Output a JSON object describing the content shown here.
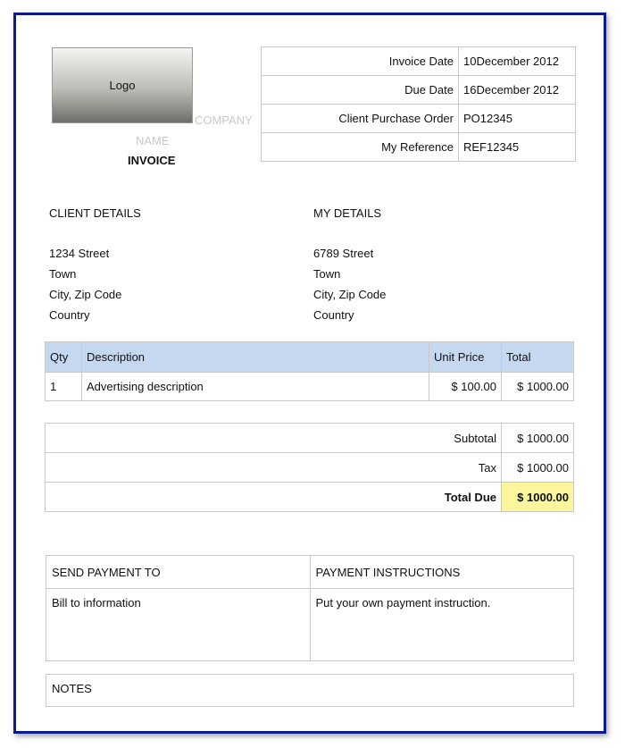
{
  "header": {
    "logo_text": "Logo",
    "company_word": "COMPANY",
    "name_word": "NAME",
    "document_title": "INVOICE"
  },
  "meta": [
    {
      "label": "Invoice Date",
      "value": "10December  2012"
    },
    {
      "label": "Due Date",
      "value": "16December  2012"
    },
    {
      "label": "Client Purchase Order",
      "value": "PO12345"
    },
    {
      "label": "My Reference",
      "value": "REF12345"
    }
  ],
  "client": {
    "heading": "CLIENT DETAILS",
    "lines": [
      "1234 Street",
      "Town",
      "City, Zip Code",
      "Country"
    ]
  },
  "mine": {
    "heading": "MY DETAILS",
    "lines": [
      "6789 Street",
      "Town",
      "City, Zip Code",
      "Country"
    ]
  },
  "items": {
    "headers": [
      "Qty",
      "Description",
      "Unit Price",
      "Total"
    ],
    "rows": [
      {
        "qty": "1",
        "description": "Advertising description",
        "unit_price": "$ 100.00",
        "total": "$ 1000.00"
      }
    ]
  },
  "totals": {
    "subtotal_label": "Subtotal",
    "subtotal_value": "$ 1000.00",
    "tax_label": "Tax",
    "tax_value": "$ 1000.00",
    "due_label": "Total Due",
    "due_value": "$ 1000.00"
  },
  "payment": {
    "send_heading": "SEND PAYMENT TO",
    "send_body": "Bill to information",
    "instr_heading": "PAYMENT INSTRUCTIONS",
    "instr_body": "Put your own payment instruction."
  },
  "notes": {
    "heading": "NOTES"
  },
  "colors": {
    "border": "#0b1a8c",
    "table_header": "#c6d8ef",
    "total_due_highlight": "#fbf59b"
  }
}
